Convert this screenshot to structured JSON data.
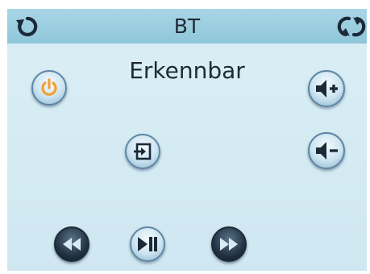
{
  "topbar": {
    "title": "BT",
    "left_icon": "back-arrow-icon",
    "right_icon": "refresh-icon"
  },
  "status": {
    "text": "Erkennbar"
  },
  "buttons": {
    "power": "power-icon",
    "input": "input-source-icon",
    "volume_up": "volume-up-icon",
    "volume_down": "volume-down-icon",
    "rewind": "rewind-icon",
    "play_pause": "play-pause-icon",
    "fast_forward": "fast-forward-icon"
  },
  "colors": {
    "topbar": "#9ccfe1",
    "background": "#d6ecf4",
    "power_accent": "#f0a032",
    "icon_dark": "#1c2a38"
  }
}
